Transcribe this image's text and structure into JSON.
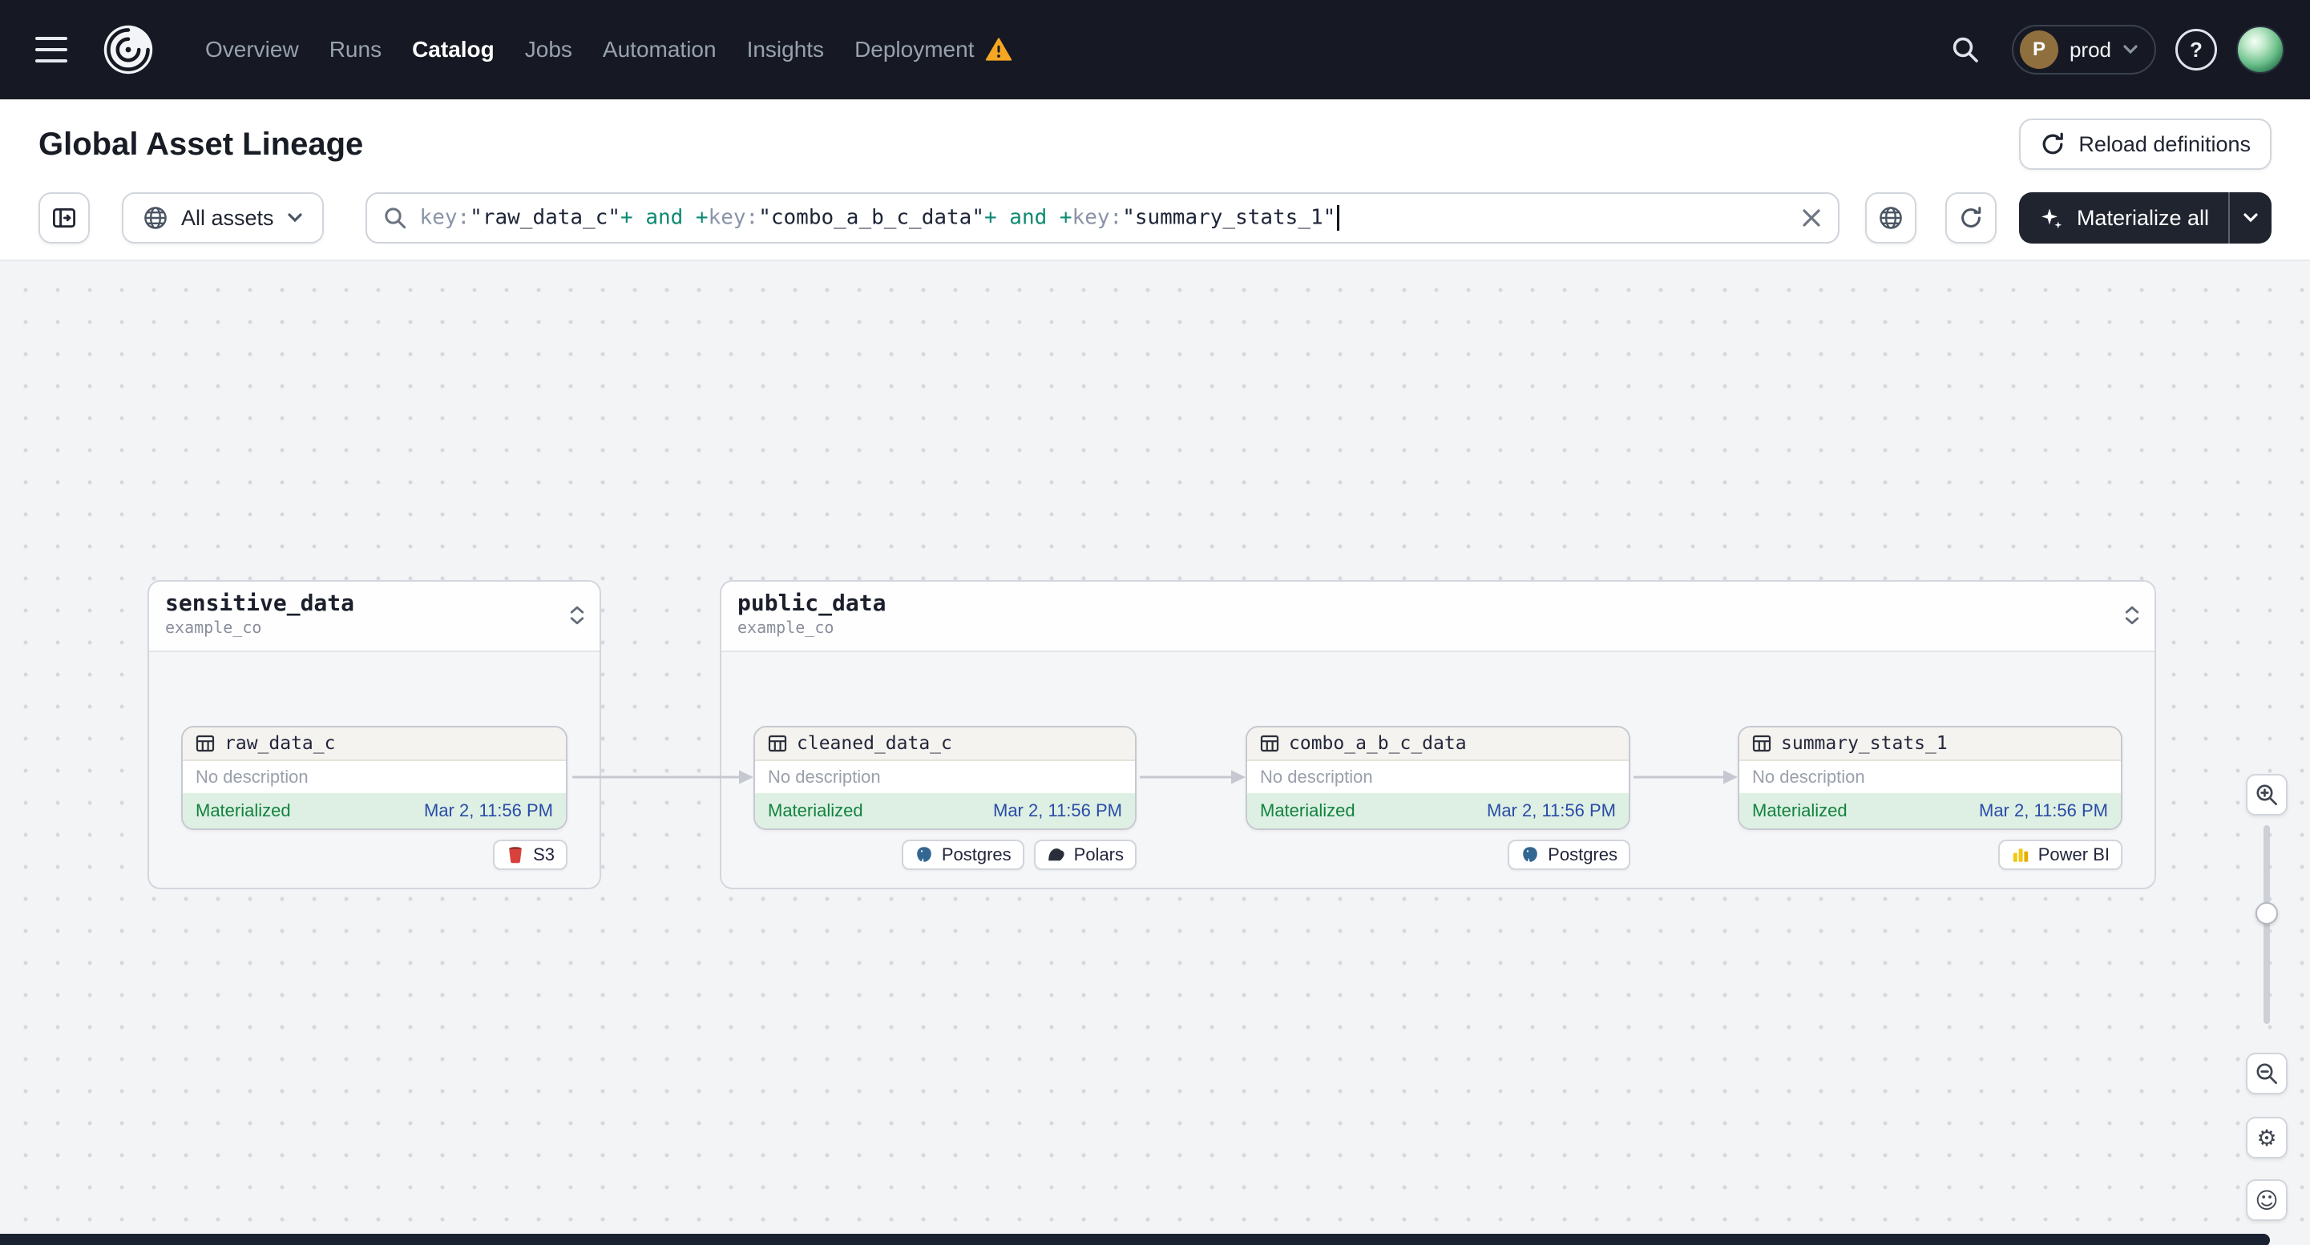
{
  "nav": {
    "links": [
      {
        "label": "Overview"
      },
      {
        "label": "Runs"
      },
      {
        "label": "Catalog"
      },
      {
        "label": "Jobs"
      },
      {
        "label": "Automation"
      },
      {
        "label": "Insights"
      },
      {
        "label": "Deployment"
      }
    ],
    "active_link": "Catalog",
    "environment": {
      "initial": "P",
      "name": "prod"
    }
  },
  "header": {
    "title": "Global Asset Lineage",
    "reload_button_label": "Reload definitions"
  },
  "toolbar": {
    "filter_button_label": "All assets",
    "materialize_button_label": "Materialize all",
    "query": {
      "tokens": [
        {
          "text": "key:",
          "type": "key"
        },
        {
          "text": "\"raw_data_c\"",
          "type": "value"
        },
        {
          "text": "+ and +",
          "type": "op"
        },
        {
          "text": "key:",
          "type": "key"
        },
        {
          "text": "\"combo_a_b_c_data\"",
          "type": "value"
        },
        {
          "text": "+ and +",
          "type": "op"
        },
        {
          "text": "key:",
          "type": "key"
        },
        {
          "text": "\"summary_stats_1\"",
          "type": "value"
        }
      ]
    }
  },
  "graph": {
    "groups": [
      {
        "name": "sensitive_data",
        "repo": "example_co"
      },
      {
        "name": "public_data",
        "repo": "example_co"
      }
    ],
    "nodes": [
      {
        "name": "raw_data_c",
        "description": "No description",
        "status": "Materialized",
        "timestamp": "Mar 2, 11:56 PM",
        "tags": [
          {
            "label": "S3"
          }
        ]
      },
      {
        "name": "cleaned_data_c",
        "description": "No description",
        "status": "Materialized",
        "timestamp": "Mar 2, 11:56 PM",
        "tags": [
          {
            "label": "Postgres"
          },
          {
            "label": "Polars"
          }
        ]
      },
      {
        "name": "combo_a_b_c_data",
        "description": "No description",
        "status": "Materialized",
        "timestamp": "Mar 2, 11:56 PM",
        "tags": [
          {
            "label": "Postgres"
          }
        ]
      },
      {
        "name": "summary_stats_1",
        "description": "No description",
        "status": "Materialized",
        "timestamp": "Mar 2, 11:56 PM",
        "tags": [
          {
            "label": "Power BI"
          }
        ]
      }
    ]
  },
  "colors": {
    "nav_bg": "#161923",
    "materialized_green": "#12823f",
    "materialized_bg": "#def0e3",
    "timestamp_blue": "#2a4ba8",
    "query_operator_teal": "#0c8a72",
    "warning_yellow": "#F5A623"
  }
}
